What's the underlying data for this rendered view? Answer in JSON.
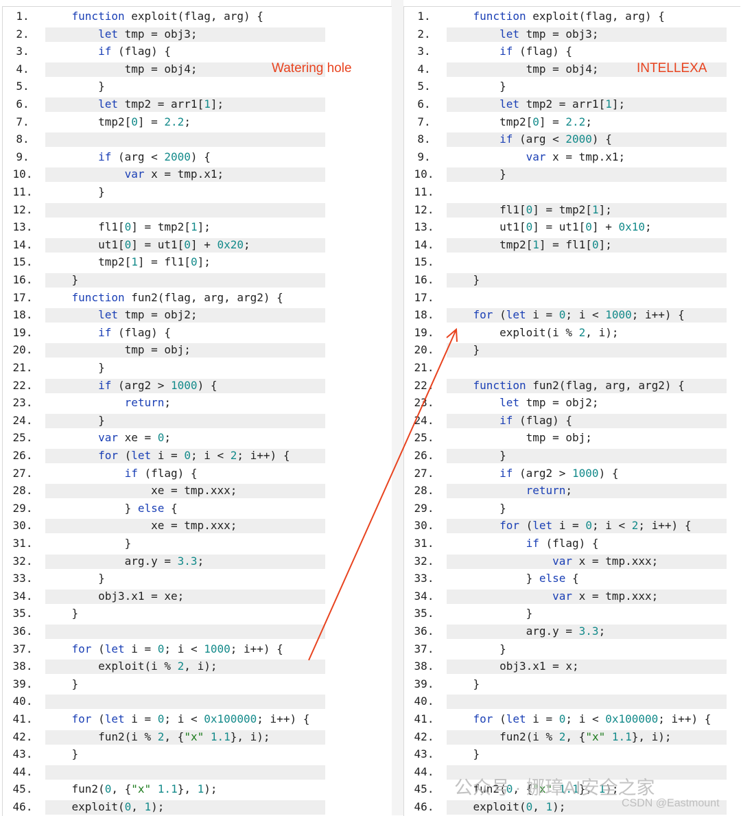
{
  "left": {
    "annotation": "Watering hole",
    "lines": [
      "    function exploit(flag, arg) {",
      "        let tmp = obj3;",
      "        if (flag) {",
      "            tmp = obj4;",
      "        }",
      "        let tmp2 = arr1[1];",
      "        tmp2[0] = 2.2;",
      "",
      "        if (arg < 2000) {",
      "            var x = tmp.x1;",
      "        }",
      "",
      "        fl1[0] = tmp2[1];",
      "        ut1[0] = ut1[0] + 0x20;",
      "        tmp2[1] = fl1[0];",
      "    }",
      "    function fun2(flag, arg, arg2) {",
      "        let tmp = obj2;",
      "        if (flag) {",
      "            tmp = obj;",
      "        }",
      "        if (arg2 > 1000) {",
      "            return;",
      "        }",
      "        var xe = 0;",
      "        for (let i = 0; i < 2; i++) {",
      "            if (flag) {",
      "                xe = tmp.xxx;",
      "            } else {",
      "                xe = tmp.xxx;",
      "            }",
      "            arg.y = 3.3;",
      "        }",
      "        obj3.x1 = xe;",
      "    }",
      "",
      "    for (let i = 0; i < 1000; i++) {",
      "        exploit(i % 2, i);",
      "    }",
      "",
      "    for (let i = 0; i < 0x100000; i++) {",
      "        fun2(i % 2, {\"x\": 1.1}, i);",
      "    }",
      "",
      "    fun2(0, {\"x\": 1.1}, 1);",
      "    exploit(0, 1);"
    ]
  },
  "right": {
    "annotation": "INTELLEXA",
    "lines": [
      "    function exploit(flag, arg) {",
      "        let tmp = obj3;",
      "        if (flag) {",
      "            tmp = obj4;",
      "        }",
      "        let tmp2 = arr1[1];",
      "        tmp2[0] = 2.2;",
      "        if (arg < 2000) {",
      "            var x = tmp.x1;",
      "        }",
      "",
      "        fl1[0] = tmp2[1];",
      "        ut1[0] = ut1[0] + 0x10;",
      "        tmp2[1] = fl1[0];",
      "",
      "    }",
      "",
      "    for (let i = 0; i < 1000; i++) {",
      "        exploit(i % 2, i);",
      "    }",
      "",
      "    function fun2(flag, arg, arg2) {",
      "        let tmp = obj2;",
      "        if (flag) {",
      "            tmp = obj;",
      "        }",
      "        if (arg2 > 1000) {",
      "            return;",
      "        }",
      "        for (let i = 0; i < 2; i++) {",
      "            if (flag) {",
      "                var x = tmp.xxx;",
      "            } else {",
      "                var x = tmp.xxx;",
      "            }",
      "            arg.y = 3.3;",
      "        }",
      "        obj3.x1 = x;",
      "    }",
      "",
      "    for (let i = 0; i < 0x100000; i++) {",
      "        fun2(i % 2, {\"x\": 1.1}, i);",
      "    }",
      "",
      "    fun2(0, {\"x\": 1.1}, 1);",
      "    exploit(0, 1);"
    ]
  },
  "watermark": {
    "wechat": "公众号 · 娜璋AI安全之家",
    "csdn": "CSDN @Eastmount"
  },
  "colors": {
    "keyword": "#1a3fb5",
    "number": "#138a8a",
    "string": "#1b7a1b",
    "annotation": "#e8431f",
    "arrow": "#e8431f"
  }
}
